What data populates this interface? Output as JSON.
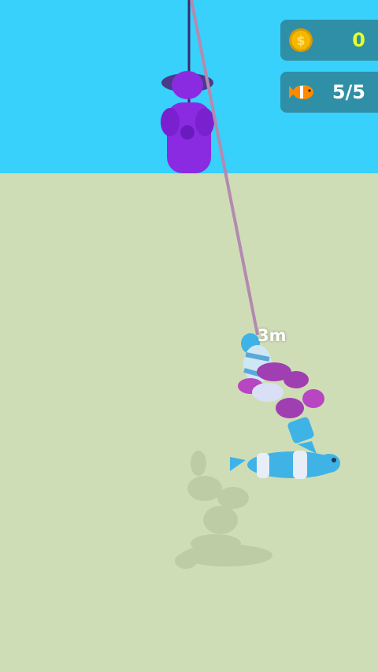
{
  "hud": {
    "coins": {
      "icon": "coin-icon",
      "value": "0"
    },
    "fish": {
      "icon": "fish-icon",
      "value": "5/5"
    }
  },
  "line": {
    "depth_label": "3m"
  },
  "colors": {
    "sky": "#37d1fb",
    "water": "#cfddb6",
    "hud_panel": "#2f8fa6",
    "coin_text": "#e6ff2e",
    "fisherman": "#8a2be2",
    "line": "#b48ab0"
  }
}
